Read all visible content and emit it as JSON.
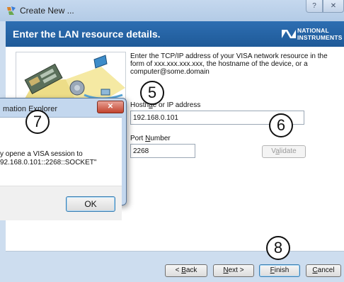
{
  "window": {
    "title": "Create New ...",
    "help_label": "?",
    "close_label": "✕"
  },
  "header": {
    "title": "Enter the LAN resource details.",
    "logo_line1": "NATIONAL",
    "logo_line2": "INSTRUMENTS"
  },
  "content": {
    "instructions": "Enter the TCP/IP address of your VISA network resource in the form of xxx.xxx.xxx.xxx, the hostname of the device, or a computer@some.domain",
    "hostname_label_pre": "Hostn",
    "hostname_label_mid": "a",
    "hostname_label_post": "e or IP address",
    "hostname_value": "192.168.0.101",
    "port_label_pre": "Port ",
    "port_label_underline": "N",
    "port_label_post": "umber",
    "port_value": "2268",
    "validate_pre": "V",
    "validate_underline": "a",
    "validate_post": "lidate"
  },
  "footer": {
    "back_pre": "< ",
    "back_underline": "B",
    "back_post": "ack",
    "next_pre": "",
    "next_underline": "N",
    "next_post": "ext >",
    "finish_underline": "F",
    "finish_post": "inish",
    "cancel_underline": "C",
    "cancel_post": "ancel"
  },
  "dialog": {
    "title": "mation Explorer",
    "close_label": "✕",
    "message_line1": "y opene  a VISA session to",
    "message_line2": "92.168.0.101::2268::SOCKET\"",
    "ok_label": "OK"
  },
  "callouts": {
    "step5": "5",
    "step6": "6",
    "step7": "7",
    "step8": "8"
  },
  "colors": {
    "header_blue": "#2566a8",
    "window_frame": "#cdddef",
    "dialog_close_red": "#c2432e"
  },
  "icons": {
    "app_icon": "create-new-icon",
    "logo_icon": "ni-eagle-icon"
  }
}
